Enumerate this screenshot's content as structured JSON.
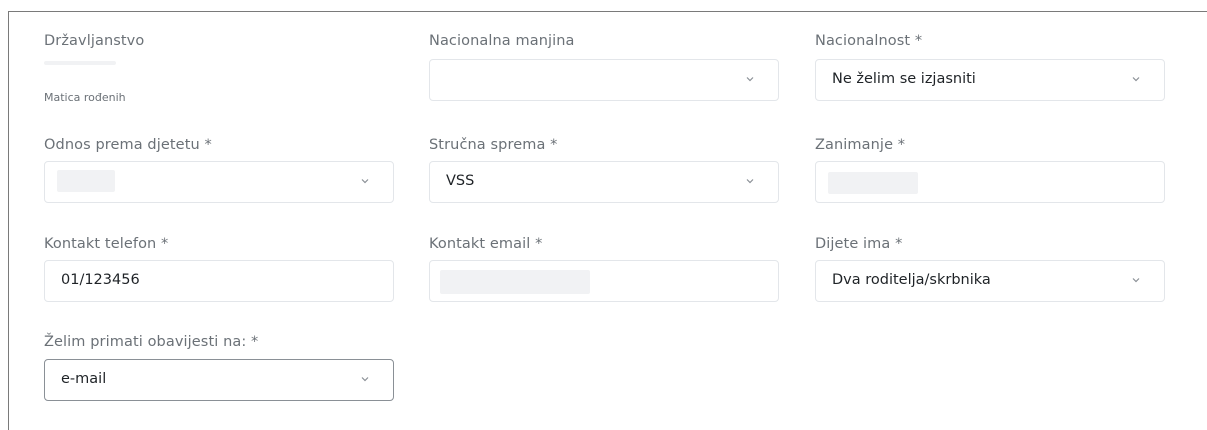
{
  "form": {
    "drzavljanstvo": {
      "label": "Državljanstvo",
      "sublabel": "Matica rođenih"
    },
    "nacionalna_manjina": {
      "label": "Nacionalna manjina",
      "value": ""
    },
    "nacionalnost": {
      "label": "Nacionalnost *",
      "value": "Ne želim se izjasniti"
    },
    "odnos_prema_djetetu": {
      "label": "Odnos prema djetetu *",
      "value": ""
    },
    "strucna_sprema": {
      "label": "Stručna sprema *",
      "value": "VSS"
    },
    "zanimanje": {
      "label": "Zanimanje *",
      "value": ""
    },
    "kontakt_telefon": {
      "label": "Kontakt telefon *",
      "value": "01/123456"
    },
    "kontakt_email": {
      "label": "Kontakt email *",
      "value": ""
    },
    "dijete_ima": {
      "label": "Dijete ima *",
      "value": "Dva roditelja/skrbnika"
    },
    "obavijesti": {
      "label": "Želim primati obavijesti na: *",
      "value": "e-mail"
    }
  },
  "icons": {
    "select_arrow": "chevron-down-icon"
  },
  "colors": {
    "label": "#6b7177",
    "border": "#e3e6ea",
    "focus_border": "#8a9096"
  }
}
